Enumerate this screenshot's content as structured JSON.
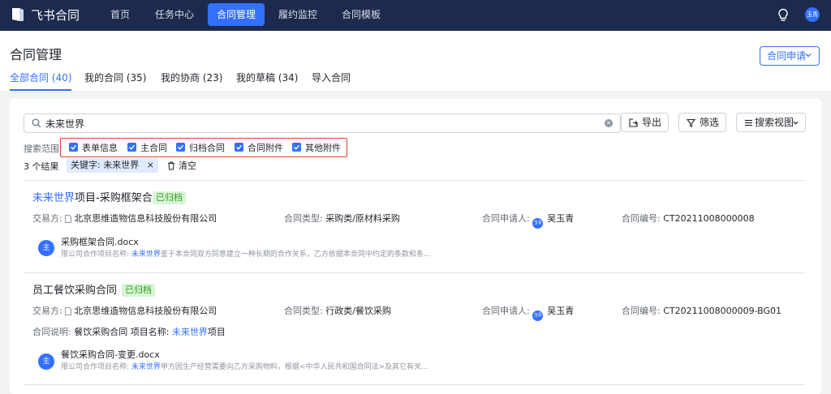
{
  "topbar": {
    "app_title": "飞书合同",
    "nav": [
      "首页",
      "任务中心",
      "合同管理",
      "履约监控",
      "合同模板"
    ],
    "active_nav": "合同管理",
    "user_avatar": "玉青",
    "accent": "#3370ff",
    "bg": "#1c2a4d"
  },
  "header": {
    "title": "合同管理",
    "apply_button": "合同申请",
    "tabs": [
      "全部合同 (40)",
      "我的合同 (35)",
      "我的协商 (23)",
      "我的草稿 (34)",
      "导入合同"
    ]
  },
  "search": {
    "value": "未来世界",
    "export_label": "导出",
    "filter_label": "筛选",
    "view_label": "搜索视图"
  },
  "scope": {
    "label": "搜索范围:",
    "options": [
      "表单信息",
      "主合同",
      "归档合同",
      "合同附件",
      "其他附件"
    ]
  },
  "results_bar": {
    "count": "3 个结果",
    "keyword_tag": "关键字:  未来世界",
    "clear_label": "清空"
  },
  "results": [
    {
      "title_hl": "未来世界",
      "title_rest": "项目-采购框架合同",
      "status": "已归档",
      "counterparty_label": "交易方:",
      "counterparty": "北京思维造物信息科技股份有限公司",
      "type_label": "合同类型:",
      "type": "采购类/原材料采购",
      "applicant_label": "合同申请人:",
      "applicant_avatar": "玉青",
      "applicant": "吴玉青",
      "number_label": "合同编号:",
      "number": "CT20211008000008",
      "file_avatar": "主",
      "file_name": "采购框架合同.docx",
      "snippet_pre": "限公司合作项目名称: ",
      "snippet_hl": "未来世界",
      "snippet_post": "鉴于本合同双方同意建立一种长期的合作关系，乙方依据本合同中约定的条款和条..."
    },
    {
      "title": "员工餐饮采购合同",
      "status": "已归档",
      "counterparty_label": "交易方:",
      "counterparty": "北京思维造物信息科技股份有限公司",
      "type_label": "合同类型:",
      "type": "行政类/餐饮采购",
      "applicant_label": "合同申请人:",
      "applicant_avatar": "玉青",
      "applicant": "吴玉青",
      "number_label": "合同编号:",
      "number": "CT20211008000009-BG01",
      "desc_label": "合同说明:",
      "desc_pre": "餐饮采购合同 项目名称: ",
      "desc_hl": "未来世界",
      "desc_post": "项目",
      "file_avatar": "主",
      "file_name": "餐饮采购合同-变更.docx",
      "snippet_pre": "限公司合作项目名称: ",
      "snippet_hl": "未来世界",
      "snippet_post": "甲方因生产经营需要向乙方采购物料，根据<中华人民共和国合同法>及其它有关..."
    }
  ]
}
